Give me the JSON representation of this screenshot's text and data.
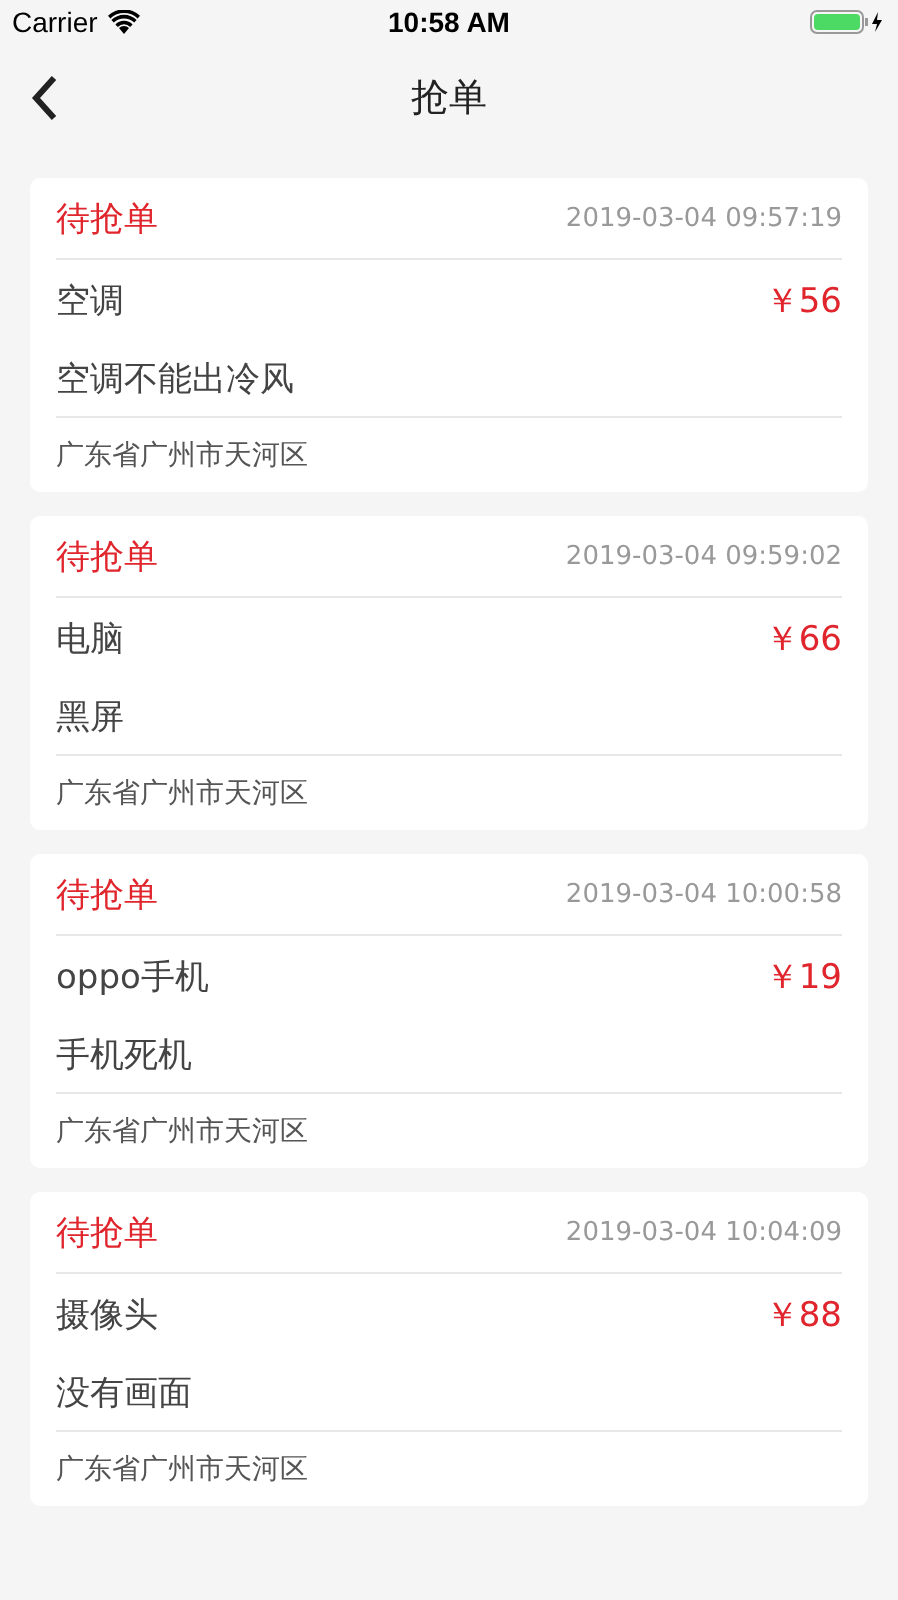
{
  "status_bar": {
    "carrier": "Carrier",
    "time": "10:58 AM"
  },
  "nav": {
    "title": "抢单"
  },
  "orders": [
    {
      "status": "待抢单",
      "time": "2019-03-04 09:57:19",
      "item": "空调",
      "price": "￥56",
      "problem": "空调不能出冷风",
      "address": "广东省广州市天河区"
    },
    {
      "status": "待抢单",
      "time": "2019-03-04 09:59:02",
      "item": "电脑",
      "price": "￥66",
      "problem": "黑屏",
      "address": "广东省广州市天河区"
    },
    {
      "status": "待抢单",
      "time": "2019-03-04 10:00:58",
      "item": "oppo手机",
      "price": "￥19",
      "problem": "手机死机",
      "address": "广东省广州市天河区"
    },
    {
      "status": "待抢单",
      "time": "2019-03-04 10:04:09",
      "item": "摄像头",
      "price": "￥88",
      "problem": "没有画面",
      "address": "广东省广州市天河区"
    }
  ]
}
